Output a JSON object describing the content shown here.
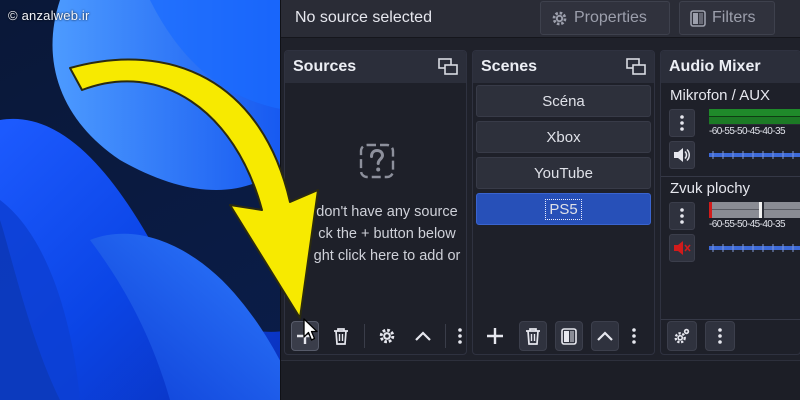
{
  "watermark": {
    "text": "anzalweb.ir",
    "icon": "copyright-icon"
  },
  "top_bar": {
    "selection_text": "No source selected",
    "properties_label": "Properties",
    "filters_label": "Filters"
  },
  "sources_dock": {
    "title": "Sources",
    "empty_lines": [
      "don't have any source",
      "ck the + button below",
      "ght click here to add or"
    ],
    "toolbar": [
      "add-icon",
      "trash-icon",
      "gear-icon",
      "chevron-up-icon",
      "more-icon"
    ]
  },
  "scenes_dock": {
    "title": "Scenes",
    "items": [
      {
        "label": "Scéna",
        "selected": false
      },
      {
        "label": "Xbox",
        "selected": false
      },
      {
        "label": "YouTube",
        "selected": false
      },
      {
        "label": "PS5",
        "selected": true
      }
    ],
    "toolbar": [
      "add-icon",
      "trash-icon",
      "filter-icon",
      "chevron-up-icon",
      "more-icon"
    ]
  },
  "audio_mixer": {
    "title": "Audio Mixer",
    "channels": [
      {
        "name": "Mikrofon / AUX",
        "muted": false,
        "scale": "-60-55-50-45-40-35"
      },
      {
        "name": "Zvuk plochy",
        "muted": true,
        "scale": "-60-55-50-45-40-35"
      }
    ],
    "toolbar": [
      "gear-icon",
      "more-icon"
    ]
  },
  "colors": {
    "accent_selected": "#2750b8",
    "arrow": "#f7ea00",
    "meter_green": "#1f8a2a",
    "mute_red": "#d21b1b"
  }
}
